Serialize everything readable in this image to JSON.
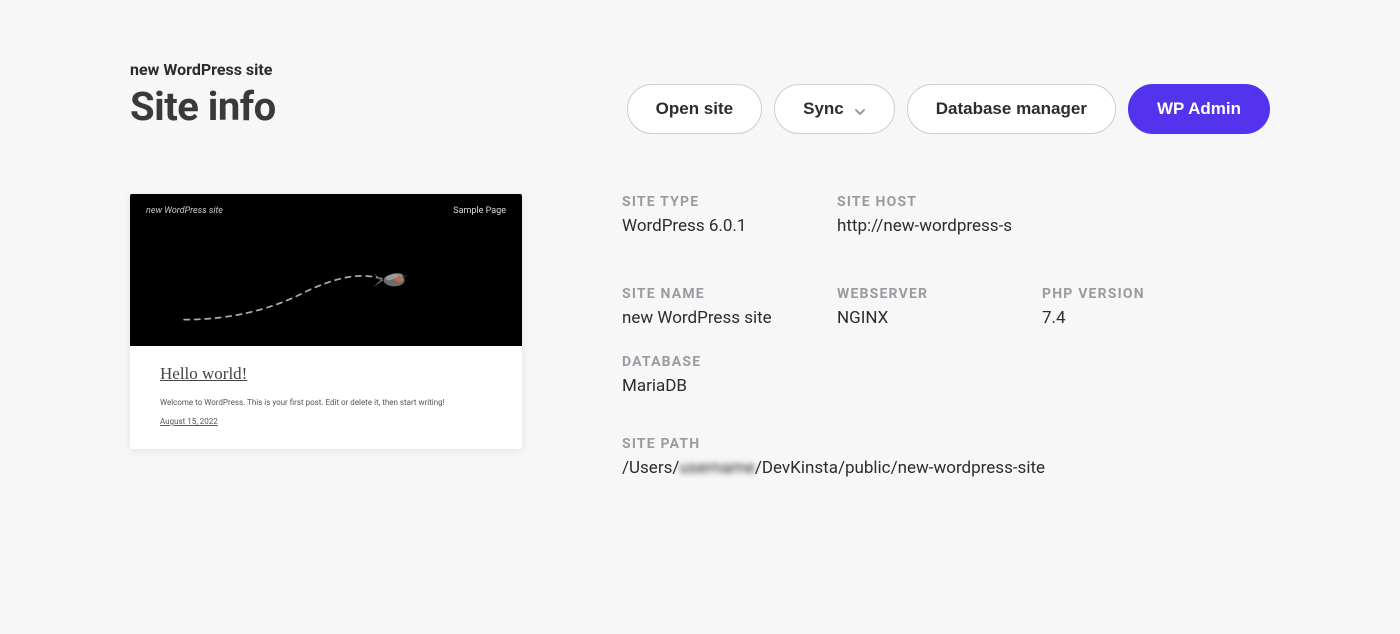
{
  "header": {
    "site_name_small": "new WordPress site",
    "page_title": "Site info",
    "actions": {
      "open_site": "Open site",
      "sync": "Sync",
      "database_manager": "Database manager",
      "wp_admin": "WP Admin"
    }
  },
  "preview": {
    "site_name": "new WordPress site",
    "sample_page": "Sample Page",
    "hello": "Hello world!",
    "welcome": "Welcome to WordPress. This is your first post. Edit or delete it, then start writing!",
    "date": "August 15, 2022"
  },
  "info": {
    "site_type": {
      "label": "SITE TYPE",
      "value": "WordPress 6.0.1"
    },
    "site_host": {
      "label": "SITE HOST",
      "value": "http://new-wordpress-s"
    },
    "site_name": {
      "label": "SITE NAME",
      "value": "new WordPress site"
    },
    "webserver": {
      "label": "WEBSERVER",
      "value": "NGINX"
    },
    "php_version": {
      "label": "PHP VERSION",
      "value": "7.4"
    },
    "database": {
      "label": "DATABASE",
      "value": "MariaDB"
    },
    "site_path": {
      "label": "SITE PATH",
      "prefix": "/Users/",
      "redacted": "username",
      "suffix": "/DevKinsta/public/new-wordpress-site"
    }
  }
}
